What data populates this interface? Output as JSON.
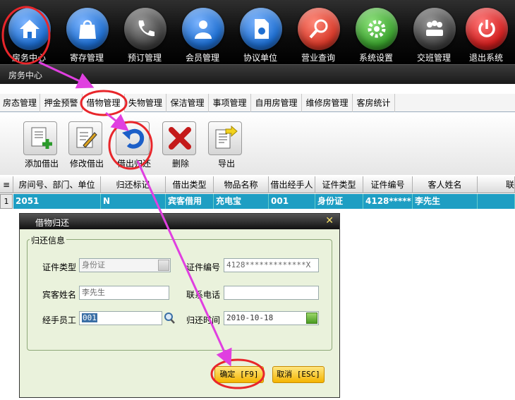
{
  "top_nav": [
    {
      "label": "房务中心",
      "icon": "home-icon",
      "color": "#1f6fd1"
    },
    {
      "label": "寄存管理",
      "icon": "shopping-bag-icon",
      "color": "#1f6fd1"
    },
    {
      "label": "预订管理",
      "icon": "phone-icon",
      "color": "#444444"
    },
    {
      "label": "会员管理",
      "icon": "user-icon",
      "color": "#1f6fd1"
    },
    {
      "label": "协议单位",
      "icon": "document-icon",
      "color": "#1f6fd1"
    },
    {
      "label": "营业查询",
      "icon": "search-icon",
      "color": "#d83a2a"
    },
    {
      "label": "系统设置",
      "icon": "gear-icon",
      "color": "#3ca32f"
    },
    {
      "label": "交班管理",
      "icon": "team-icon",
      "color": "#444444"
    },
    {
      "label": "退出系统",
      "icon": "power-icon",
      "color": "#d32020"
    }
  ],
  "section_title": "房务中心",
  "sub_tabs": [
    "房态管理",
    "押金预警",
    "借物管理",
    "失物管理",
    "保洁管理",
    "事项管理",
    "自用房管理",
    "维修房管理",
    "客房统计"
  ],
  "actions": [
    {
      "label": "添加借出",
      "icon": "add-document-icon"
    },
    {
      "label": "修改借出",
      "icon": "edit-document-icon"
    },
    {
      "label": "借出归还",
      "icon": "return-arrow-icon"
    },
    {
      "label": "删除",
      "icon": "delete-x-icon"
    },
    {
      "label": "导出",
      "icon": "export-icon"
    }
  ],
  "grid": {
    "columns": [
      "房间号、部门、单位",
      "归还标记",
      "借出类型",
      "物品名称",
      "借出经手人",
      "证件类型",
      "证件编号",
      "客人姓名",
      "联"
    ],
    "rows": [
      {
        "index": "1",
        "cells": [
          "2051",
          "N",
          "宾客借用",
          "充电宝",
          "001",
          "身份证",
          "4128*****",
          "李先生",
          ""
        ]
      }
    ]
  },
  "dialog": {
    "title": "借物归还",
    "group_title": "归还信息",
    "fields": {
      "id_type_label": "证件类型",
      "id_type_value": "身份证",
      "id_number_label": "证件编号",
      "id_number_value": "4128*************X",
      "guest_name_label": "宾客姓名",
      "guest_name_value": "李先生",
      "phone_label": "联系电话",
      "phone_value": "",
      "handler_label": "经手员工",
      "handler_value": "001",
      "return_time_label": "归还时间",
      "return_time_value": "2010-10-18"
    },
    "confirm_label": "确定 [F9]",
    "cancel_label": "取消 [ESC]"
  },
  "colors": {
    "selected_row": "#1e9ec3",
    "annotation": "#e03fe0",
    "highlight_circle": "#e8262b",
    "dialog_bg": "#eaf2dc",
    "button": "#f4b400"
  }
}
